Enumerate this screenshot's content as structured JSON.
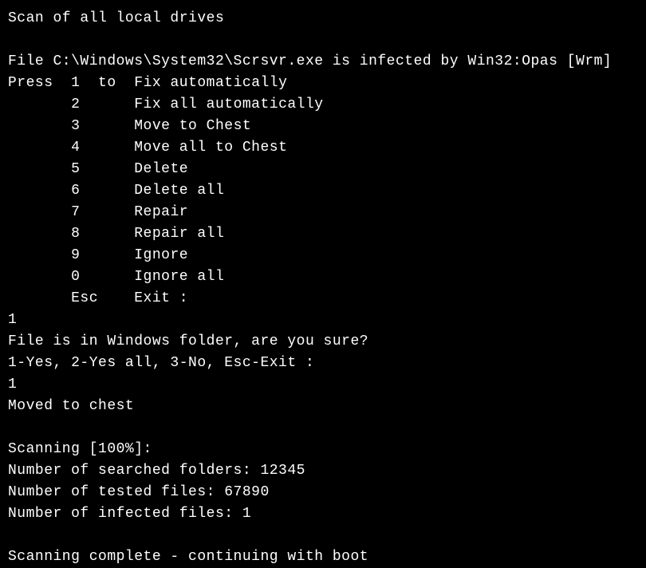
{
  "title": "Scan of all local drives",
  "infection_line": "File C:\\Windows\\System32\\Scrsvr.exe is infected by Win32:Opas [Wrm]",
  "press_prefix": "Press  ",
  "menu_to": "to  ",
  "menu": [
    {
      "key": "1",
      "label": "Fix automatically"
    },
    {
      "key": "2",
      "label": "Fix all automatically"
    },
    {
      "key": "3",
      "label": "Move to Chest"
    },
    {
      "key": "4",
      "label": "Move all to Chest"
    },
    {
      "key": "5",
      "label": "Delete"
    },
    {
      "key": "6",
      "label": "Delete all"
    },
    {
      "key": "7",
      "label": "Repair"
    },
    {
      "key": "8",
      "label": "Repair all"
    },
    {
      "key": "9",
      "label": "Ignore"
    },
    {
      "key": "0",
      "label": "Ignore all"
    },
    {
      "key": "Esc",
      "label": "Exit :"
    }
  ],
  "input1": "1",
  "confirm_line": "File is in Windows folder, are you sure?",
  "confirm_options": "1-Yes, 2-Yes all, 3-No, Esc-Exit :",
  "input2": "1",
  "result": "Moved to chest",
  "scan_progress": "Scanning [100%]:",
  "searched_folders_label": "Number of searched folders: ",
  "searched_folders": "12345",
  "tested_files_label": "Number of tested files: ",
  "tested_files": "67890",
  "infected_files_label": "Number of infected files: ",
  "infected_files": "1",
  "complete": "Scanning complete - continuing with boot"
}
